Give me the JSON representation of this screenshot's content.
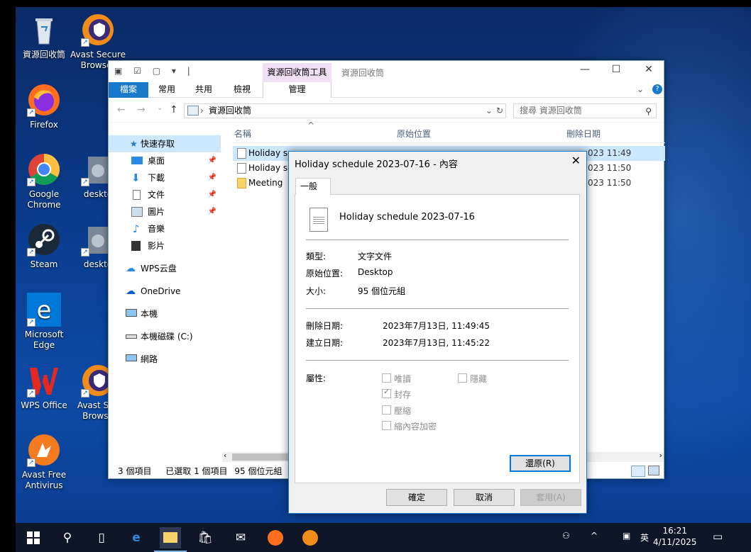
{
  "desktop": {
    "icons": [
      {
        "label": "資源回收筒",
        "label2": "",
        "icon": "recycle-bin-icon"
      },
      {
        "label": "Avast Secure",
        "label2": "Browser",
        "icon": "avast-browser-icon"
      },
      {
        "label": "Firefox",
        "label2": "",
        "icon": "firefox-icon"
      },
      {
        "label": "Google",
        "label2": "Chrome",
        "icon": "chrome-icon"
      },
      {
        "label": "deskto",
        "label2": "",
        "icon": "settings-shortcut-icon"
      },
      {
        "label": "Steam",
        "label2": "",
        "icon": "steam-icon"
      },
      {
        "label": "deskto",
        "label2": "",
        "icon": "settings-shortcut-icon"
      },
      {
        "label": "Microsoft",
        "label2": "Edge",
        "icon": "edge-icon"
      },
      {
        "label": "WPS Office",
        "label2": "",
        "icon": "wps-icon"
      },
      {
        "label": "Avast Sec",
        "label2": "Browse",
        "icon": "avast-browser-icon"
      },
      {
        "label": "Avast Free",
        "label2": "Antivirus",
        "icon": "avast-antivirus-icon"
      }
    ]
  },
  "explorer": {
    "context_tab": "資源回收筒工具",
    "window_title": "資源回收筒",
    "ribbon_tabs": {
      "file": "檔案",
      "home": "常用",
      "share": "共用",
      "view": "檢視",
      "manage": "管理"
    },
    "address": "資源回收筒",
    "search_placeholder": "搜尋 資源回收筒",
    "nav": [
      {
        "label": "快速存取"
      },
      {
        "label": "桌面"
      },
      {
        "label": "下載"
      },
      {
        "label": "文件"
      },
      {
        "label": "圖片"
      },
      {
        "label": "音樂"
      },
      {
        "label": "影片"
      },
      {
        "label": "WPS云盘"
      },
      {
        "label": "OneDrive"
      },
      {
        "label": "本機"
      },
      {
        "label": "本機磁碟 (C:)"
      },
      {
        "label": "網路"
      }
    ],
    "columns": {
      "name": "名稱",
      "original": "原始位置",
      "deleted": "刪除日期"
    },
    "rows": [
      {
        "name": "Holiday sc",
        "deleted": "023 11:49"
      },
      {
        "name": "Holiday sc",
        "deleted": "023 11:50"
      },
      {
        "name": "Meeting",
        "deleted": "023 11:50"
      }
    ],
    "status": {
      "count": "3 個項目",
      "selected": "已選取 1 個項目",
      "size": "95 個位元組"
    }
  },
  "dialog": {
    "title": "Holiday schedule 2023-07-16 - 內容",
    "tab": "一般",
    "filename": "Holiday schedule 2023-07-16",
    "type_label": "類型:",
    "type_value": "文字文件",
    "location_label": "原始位置:",
    "location_value": "Desktop",
    "size_label": "大小:",
    "size_value": "95 個位元組",
    "deleted_label": "刪除日期:",
    "deleted_value": "2023年7月13日, 11:49:45",
    "created_label": "建立日期:",
    "created_value": "2023年7月13日, 11:45:22",
    "attr_label": "屬性:",
    "attrs": {
      "readonly": "唯讀",
      "hidden": "隱藏",
      "archive": "封存",
      "compress": "壓縮",
      "encrypt": "縮內容加密"
    },
    "restore_btn": "還原(R)",
    "ok_btn": "確定",
    "cancel_btn": "取消",
    "apply_btn": "套用(A)"
  },
  "taskbar": {
    "ime": "英",
    "time": "16:21",
    "date": "4/11/2025"
  }
}
